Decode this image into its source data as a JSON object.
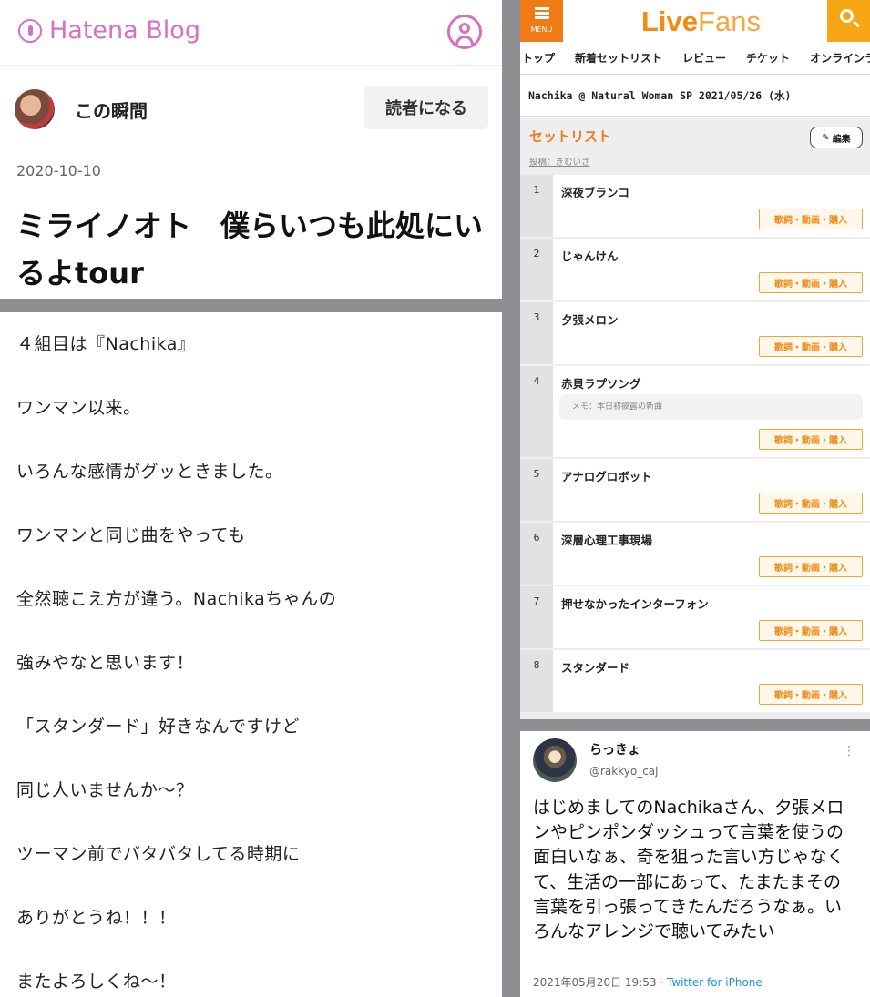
{
  "hatena": {
    "logo_text": "Hatena Blog",
    "blog_name": "この瞬間",
    "subscribe_label": "読者になる",
    "post_date": "2020-10-10",
    "post_title": "ミライノオト　僕らいつも此処にいるよtour",
    "body_lines": [
      "４組目は『Nachika』",
      "ワンマン以来。",
      "いろんな感情がグッときました。",
      "ワンマンと同じ曲をやっても",
      "全然聴こえ方が違う。Nachikaちゃんの",
      "強みやなと思います！",
      "「スタンダード」好きなんですけど",
      "同じ人いませんか〜？",
      "ツーマン前でバタバタしてる時期に",
      "ありがとうね！！！",
      "またよろしくね〜！"
    ],
    "accent_color": "#d570c4"
  },
  "livefans": {
    "menu_label": "MENU",
    "logo_live": "Live",
    "logo_fans": "Fans",
    "nav": [
      "トップ",
      "新着セットリスト",
      "レビュー",
      "チケット",
      "オンラインラ"
    ],
    "event_title": "Nachika @ Natural Woman SP 2021/05/26 (水)",
    "setlist_heading": "セットリスト",
    "edit_label": "編集",
    "poster": "投稿：きむいさ",
    "action_label": "歌詞・動画・購入",
    "memo_label": "メモ：本日初披露の新曲",
    "songs": [
      {
        "num": "1",
        "title": "深夜ブランコ"
      },
      {
        "num": "2",
        "title": "じゃんけん"
      },
      {
        "num": "3",
        "title": "夕張メロン"
      },
      {
        "num": "4",
        "title": "赤貝ラプソング"
      },
      {
        "num": "5",
        "title": "アナログロボット"
      },
      {
        "num": "6",
        "title": "深層心理工事現場"
      },
      {
        "num": "7",
        "title": "押せなかったインターフォン"
      },
      {
        "num": "8",
        "title": "スタンダード"
      }
    ],
    "brand_orange": "#f07a16"
  },
  "tweet": {
    "name": "らっきょ",
    "handle": "@rakkyo_caj",
    "text": "はじめましてのNachikaさん、夕張メロンやピンポンダッシュって言葉を使うの面白いなぁ、奇を狙った言い方じゃなくて、生活の一部にあって、たまたまその言葉を引っ張ってきたんだろうなぁ。いろんなアレンジで聴いてみたい",
    "date": "2021年05月20日 19:53",
    "source": "Twitter for iPhone"
  }
}
